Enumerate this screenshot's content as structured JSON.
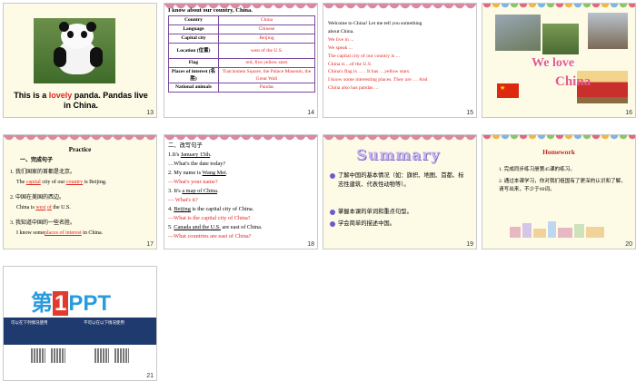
{
  "slides": {
    "s13": {
      "number": "13",
      "caption_pre": "This is a ",
      "caption_red": "lovely",
      "caption_post": " panda. Pandas live in China."
    },
    "s14": {
      "number": "14",
      "heading": "I know about our country, China.",
      "rows": [
        {
          "k": "Country",
          "v": "China"
        },
        {
          "k": "Language",
          "v": "Chinese"
        },
        {
          "k": "Capital city",
          "v": "Beijing"
        },
        {
          "k": "Location (位置)",
          "v": "west of the U.S."
        },
        {
          "k": "Flag",
          "v": "red, five yellow stars"
        },
        {
          "k": "Places of interest (名胜)",
          "v": "Tian'anmen Square, the Palace Museum, the Great Wall"
        },
        {
          "k": "National animals",
          "v": "Pandas"
        }
      ]
    },
    "s15": {
      "number": "15",
      "line1": "Welcome to China! Let me tell you something",
      "line2": "about China.",
      "l3": "We live in ...",
      "l4": "We speak ...",
      "l5": "The capital city of our country is ...",
      "l6": "China is ...of the U.S.",
      "l7": "China's flag is … . It has …yellow stars.",
      "l8": "I know some interesting places. They are … And",
      "l9": "China also has pandas. .."
    },
    "s16": {
      "number": "16",
      "we_love": "We love",
      "china": "China"
    },
    "s17": {
      "number": "17",
      "title": "Practice",
      "sub": "一、完成句子",
      "q1": "1. 我们国家的首都是北京。",
      "a1_pre": "The",
      "a1_b1": "capital",
      "a1_mid": "city of our",
      "a1_b2": "country",
      "a1_post": "is Beijing.",
      "q2": "2. 中国在美国的西边。",
      "a2_pre": "China is",
      "a2_b1": "west",
      "a2_mid": "of",
      "a2_post": "the U.S.",
      "q3": "3. 我知道中国的一些名胜。",
      "a3_pre": "I know some",
      "a3_b1": "places of interest",
      "a3_post": "in China."
    },
    "s18": {
      "number": "18",
      "title": "二、改写句子",
      "l1_pre": "1.It's ",
      "l1_u": "January 15th",
      "l1_post": ".",
      "l1a": "…What's the date today?",
      "l2_pre": "2. My name is ",
      "l2_u": "Wang Mei",
      "l2_post": ".",
      "l2a": "—What's your name?",
      "l3_pre": "3. It's ",
      "l3_u": "a map of China",
      "l3_post": ".",
      "l3a": "—  What's it?",
      "l4_pre": "4. ",
      "l4_u": "Beijing",
      "l4_post": " is the capital city of China.",
      "l4a": "—What is the capital city of China?",
      "l5_pre": "5. ",
      "l5_u": "Canada and the U.S.",
      "l5_post": " are east of China.",
      "l5a": "—What  countries are east of China?"
    },
    "s19": {
      "number": "19",
      "title": "Summary",
      "i1": "了解中国的基本情况（如：旗帜、地图、首都、标志性建筑、代表性动物等）。",
      "i2": "掌握本课的单词和重点句型。",
      "i3": "学会简单的描述中国。"
    },
    "s20": {
      "number": "20",
      "title": "Homework",
      "i1": "1. 完成同步练习册第45课的练习。",
      "i2": "2. 通过本课学习，你对我们祖国有了更深的认识和了解，请写出来，不少于60词。"
    },
    "s21": {
      "number": "21",
      "logo_pre": "第",
      "logo_one": "1",
      "logo_post": "PPT",
      "left_col": "可以在下列情况使用",
      "right_col": "不可以在以下情况使用"
    }
  },
  "colors": {
    "accent_red": "#e0261f",
    "table_border": "#7a4a9c",
    "summary": "#c7b3f0",
    "homework": "#c02a2a"
  }
}
